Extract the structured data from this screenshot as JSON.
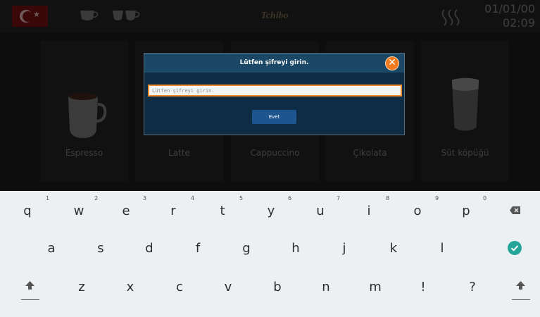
{
  "topbar": {
    "logo": "Tchibo",
    "date": "01/01/00",
    "time": "02:09",
    "flag_icon": "turkey-flag-icon",
    "heat_icon": "steam-heat-icon"
  },
  "products": [
    {
      "label": "Espresso"
    },
    {
      "label": "Latte"
    },
    {
      "label": "Cappuccino"
    },
    {
      "label": "Çikolata"
    },
    {
      "label": "Süt köpüğü"
    }
  ],
  "dialog": {
    "title": "Lütfen şifreyi girin.",
    "input_placeholder": "Lütfen şifreyi girin.",
    "input_value": "",
    "confirm_label": "Evet",
    "close_icon": "close-icon"
  },
  "keyboard": {
    "row1": [
      {
        "key": "q",
        "hint": "1"
      },
      {
        "key": "w",
        "hint": "2"
      },
      {
        "key": "e",
        "hint": "3"
      },
      {
        "key": "r",
        "hint": "4"
      },
      {
        "key": "t",
        "hint": "5"
      },
      {
        "key": "y",
        "hint": "6"
      },
      {
        "key": "u",
        "hint": "7"
      },
      {
        "key": "i",
        "hint": "8"
      },
      {
        "key": "o",
        "hint": "9"
      },
      {
        "key": "p",
        "hint": "0"
      }
    ],
    "row2": [
      "a",
      "s",
      "d",
      "f",
      "g",
      "h",
      "j",
      "k",
      "l"
    ],
    "row3": [
      "z",
      "x",
      "c",
      "v",
      "b",
      "n",
      "m",
      "!",
      "?"
    ],
    "backspace_icon": "backspace-icon",
    "enter_icon": "check-circle-icon",
    "shift_icon": "shift-icon",
    "accent_color": "#26a69a"
  }
}
